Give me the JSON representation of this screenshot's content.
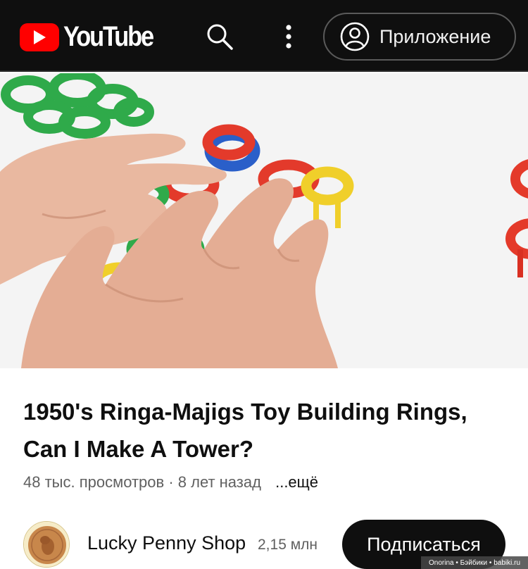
{
  "header": {
    "logo_text": "YouTube",
    "app_button_label": "Приложение",
    "icons": [
      "youtube-logo-icon",
      "search-icon",
      "more-vertical-icon",
      "account-icon"
    ],
    "colors": {
      "background": "#0f0f0f",
      "brand_red": "#ff0000"
    }
  },
  "video": {
    "title": "1950's Ringa-Majigs Toy Building Rings, Can I Make A Tower?",
    "views": "48 тыс. просмотров",
    "separator": "·",
    "age": "8 лет назад",
    "more_label": "...ещё"
  },
  "channel": {
    "name": "Lucky Penny Shop",
    "subscribers": "2,15 млн",
    "subscribe_label": "Подписаться"
  },
  "watermark": "Onorina • Бэйбики • babiki.ru"
}
